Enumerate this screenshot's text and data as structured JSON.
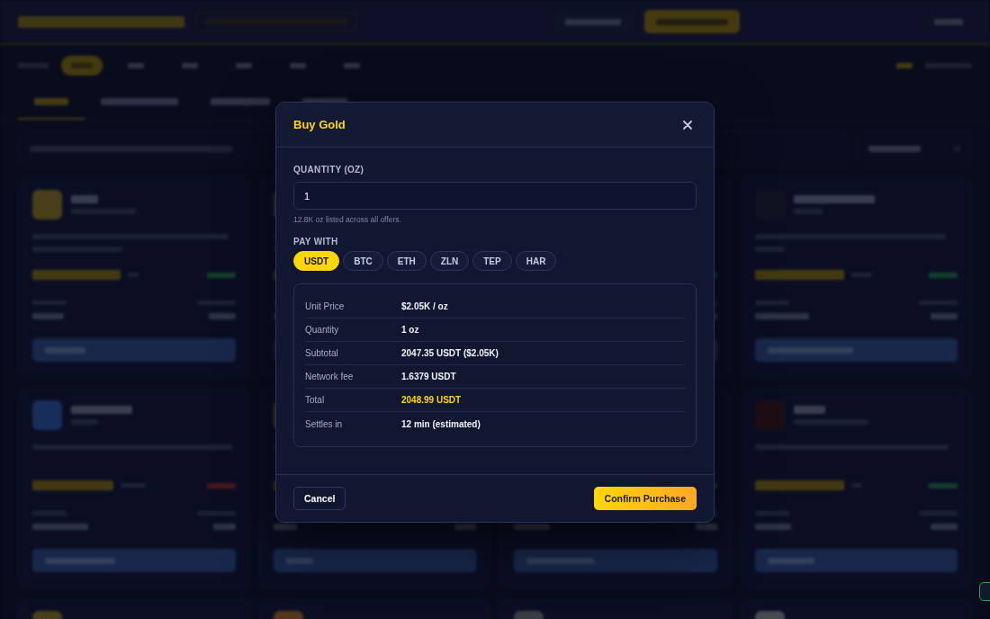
{
  "modal": {
    "title": "Buy Gold",
    "quantity": {
      "label": "QUANTITY (OZ)",
      "value": "1",
      "hint": "12.8K oz listed across all offers."
    },
    "pay_with": {
      "label": "PAY WITH",
      "options": [
        {
          "label": "USDT",
          "selected": true
        },
        {
          "label": "BTC",
          "selected": false
        },
        {
          "label": "ETH",
          "selected": false
        },
        {
          "label": "ZLN",
          "selected": false
        },
        {
          "label": "TEP",
          "selected": false
        },
        {
          "label": "HAR",
          "selected": false
        }
      ]
    },
    "summary": [
      {
        "label": "Unit Price",
        "value": "$2.05K / oz",
        "highlight": false
      },
      {
        "label": "Quantity",
        "value": "1 oz",
        "highlight": false
      },
      {
        "label": "Subtotal",
        "value": "2047.35 USDT ($2.05K)",
        "highlight": false
      },
      {
        "label": "Network fee",
        "value": "1.6379 USDT",
        "highlight": false
      },
      {
        "label": "Total",
        "value": "2048.99 USDT",
        "highlight": true
      },
      {
        "label": "Settles in",
        "value": "12 min (estimated)",
        "highlight": false
      }
    ],
    "buttons": [
      {
        "kind": "secondary",
        "label": "Cancel"
      },
      {
        "kind": "primary",
        "label": "Confirm Purchase"
      }
    ]
  }
}
